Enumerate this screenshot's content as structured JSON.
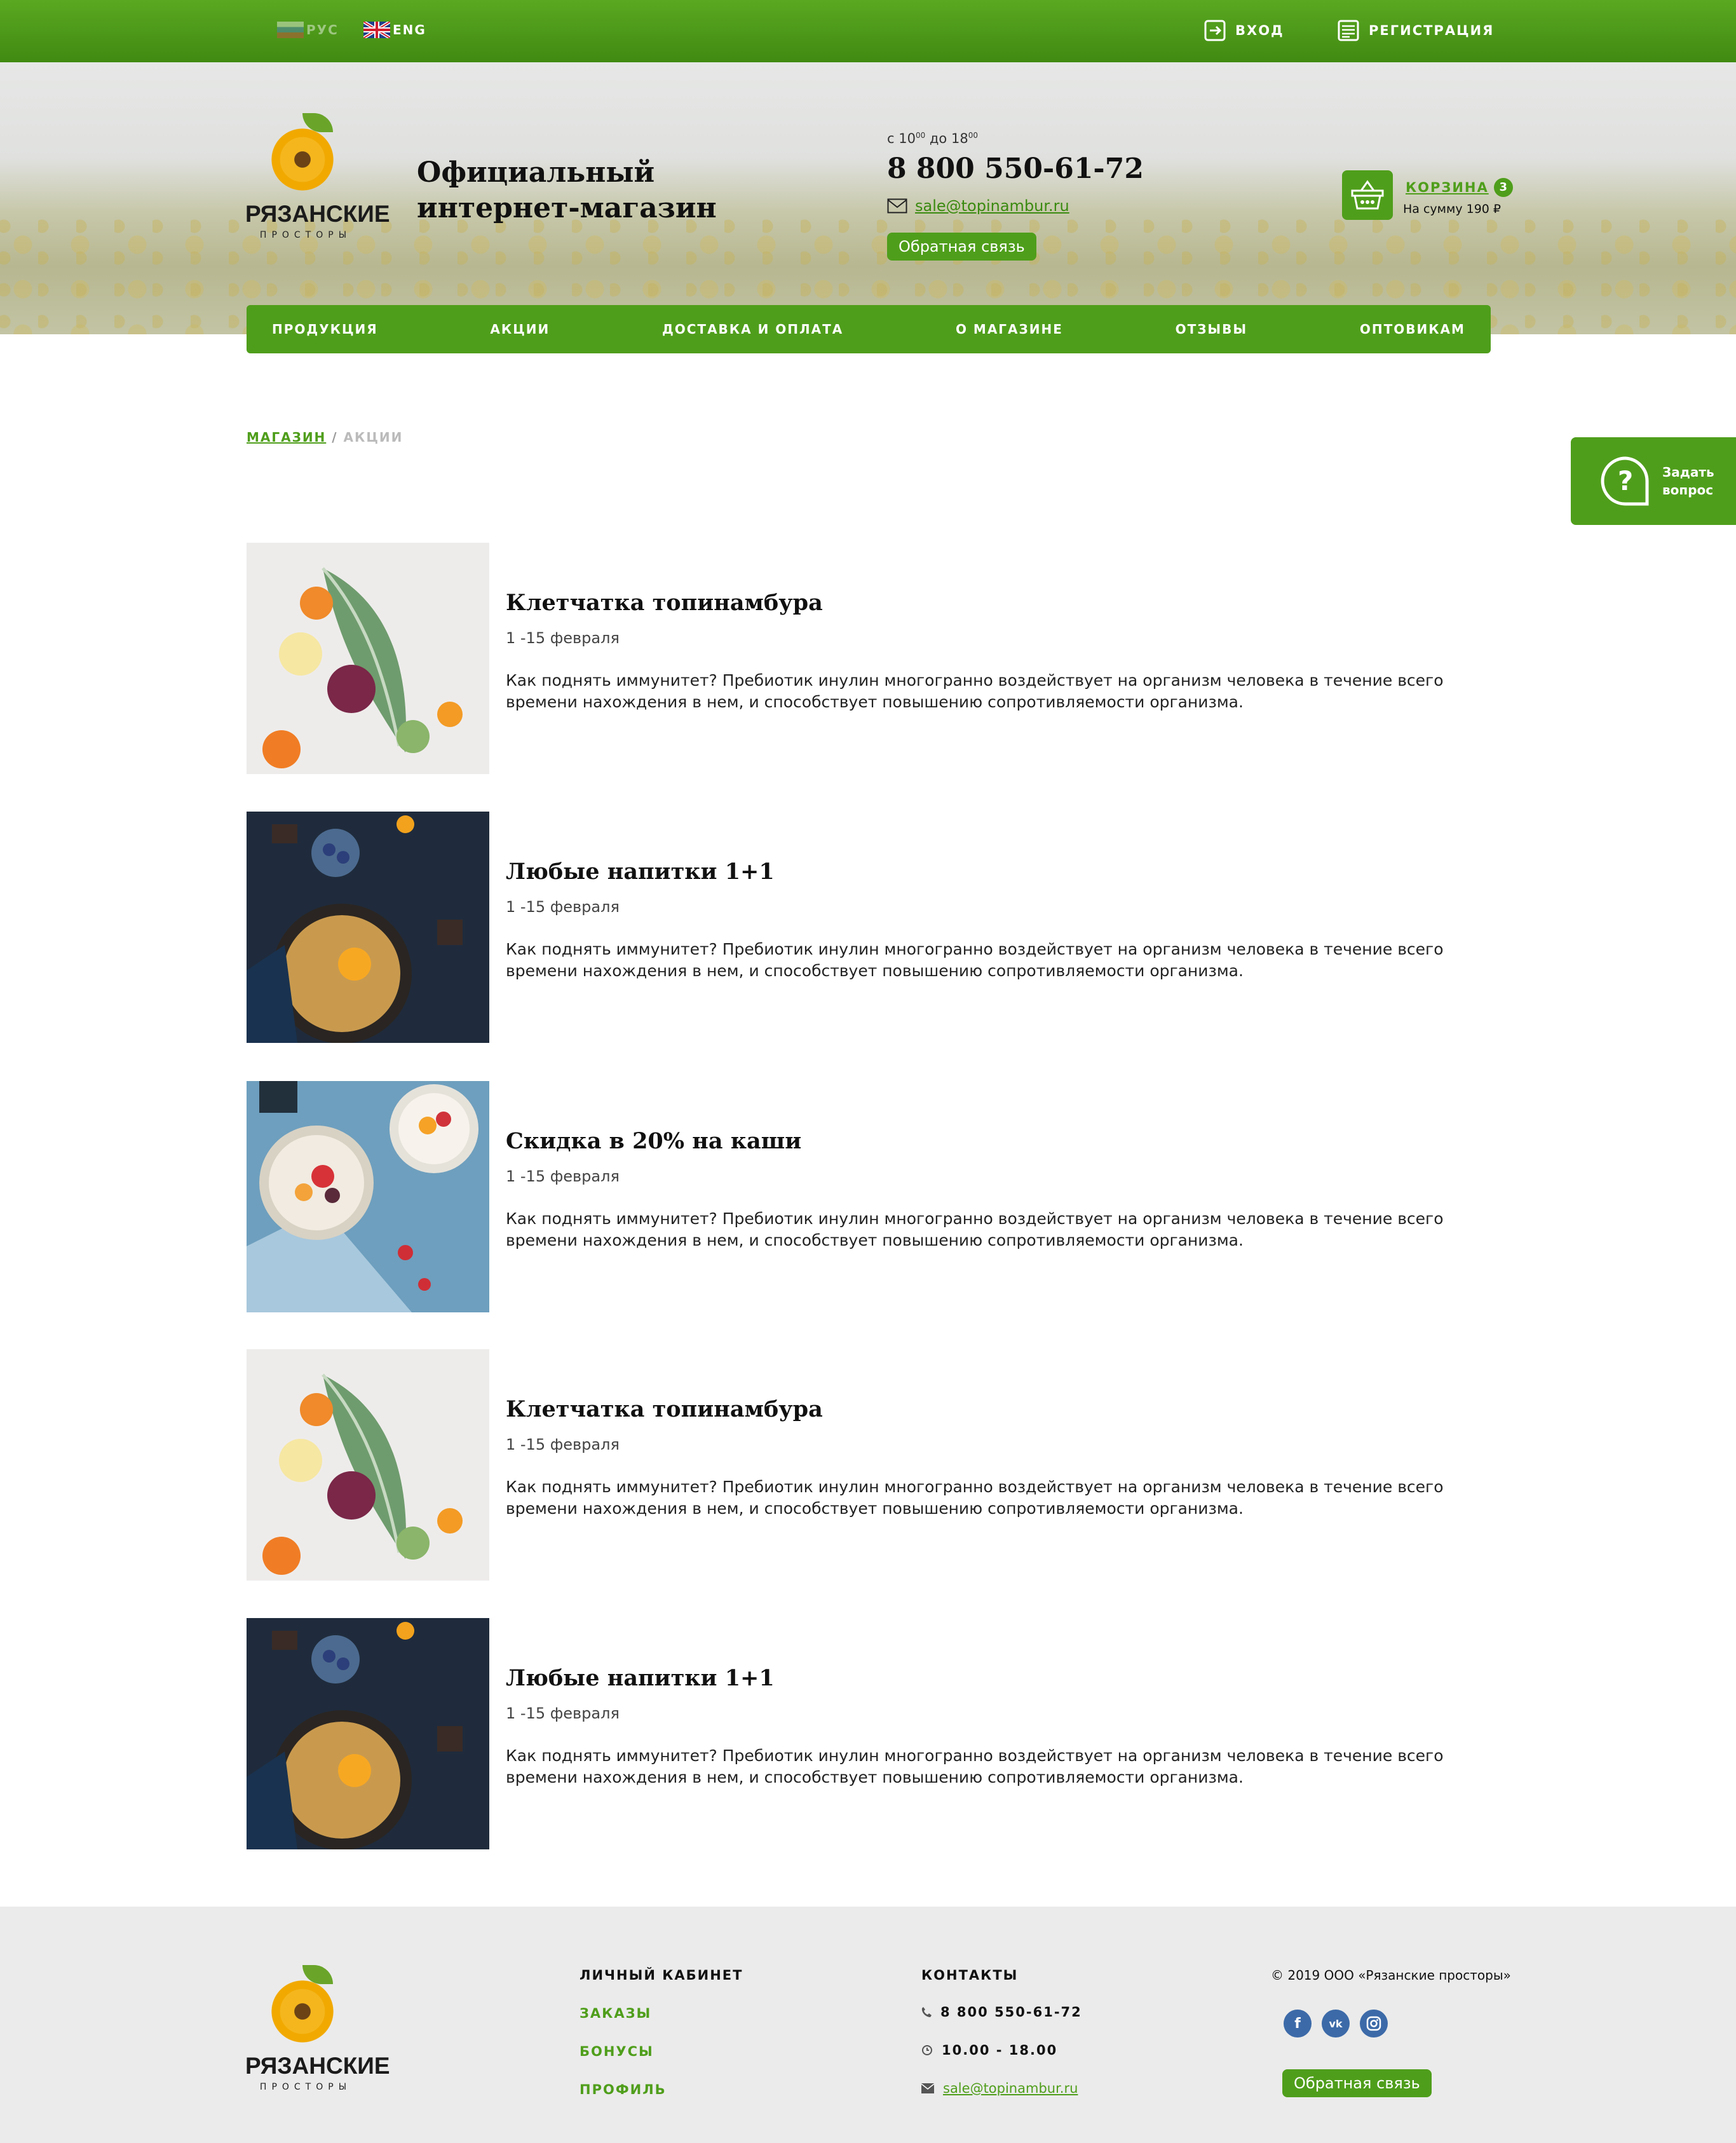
{
  "topbar": {
    "lang_ru": "РУС",
    "lang_en": "ENG",
    "login": "ВХОД",
    "register": "РЕГИСТРАЦИЯ"
  },
  "header": {
    "logo_brand": "РЯЗАНСКИЕ",
    "logo_sub": "ПРОСТОРЫ",
    "title_line1": "Официальный",
    "title_line2": "интернет-магазин",
    "hours_from": "с 10",
    "hours_from_sup": "00",
    "hours_to": " до 18",
    "hours_to_sup": "00",
    "phone": "8 800 550-61-72",
    "email": "sale@topinambur.ru",
    "feedback": "Обратная связь",
    "cart_label": "КОРЗИНА",
    "cart_count": "3",
    "cart_sum": "На сумму 190 ₽"
  },
  "nav": {
    "items": [
      "ПРОДУКЦИЯ",
      "АКЦИИ",
      "ДОСТАВКА И ОПЛАТА",
      "О МАГАЗИНЕ",
      "ОТЗЫВЫ",
      "ОПТОВИКАМ"
    ]
  },
  "breadcrumb": {
    "home": "МАГАЗИН",
    "sep": "/",
    "current": "АКЦИИ"
  },
  "ask": {
    "line1": "Задать",
    "line2": "вопрос"
  },
  "promos": [
    {
      "title": "Клетчатка топинамбура",
      "date": "1 -15 февраля",
      "text": "Как поднять иммунитет? Пребиотик инулин многогранно воздействует на организм человека в течение всего времени нахождения в нем, и способствует повышению сопротивляемости организма.",
      "image": "kale"
    },
    {
      "title": "Любые напитки 1+1",
      "date": "1 -15 февраля",
      "text": "Как поднять иммунитет? Пребиотик инулин многогранно воздействует на организм человека в течение всего времени нахождения в нем, и способствует повышению сопротивляемости организма.",
      "image": "dark"
    },
    {
      "title": "Скидка в 20% на каши",
      "date": "1 -15 февраля",
      "text": "Как поднять иммунитет? Пребиотик инулин многогранно воздействует на организм человека в течение всего времени нахождения в нем, и способствует повышению сопротивляемости организма.",
      "image": "blue"
    },
    {
      "title": "Клетчатка топинамбура",
      "date": "1 -15 февраля",
      "text": "Как поднять иммунитет? Пребиотик инулин многогранно воздействует на организм человека в течение всего времени нахождения в нем, и способствует повышению сопротивляемости организма.",
      "image": "kale"
    },
    {
      "title": "Любые напитки 1+1",
      "date": "1 -15 февраля",
      "text": "Как поднять иммунитет? Пребиотик инулин многогранно воздействует на организм человека в течение всего времени нахождения в нем, и способствует повышению сопротивляемости организма.",
      "image": "dark"
    }
  ],
  "footer": {
    "logo_brand": "РЯЗАНСКИЕ",
    "logo_sub": "ПРОСТОРЫ",
    "account_head": "ЛИЧНЫЙ КАБИНЕТ",
    "account_links": [
      "ЗАКАЗЫ",
      "БОНУСЫ",
      "ПРОФИЛЬ"
    ],
    "contacts_head": "КОНТАКТЫ",
    "phone": "8 800 550-61-72",
    "hours": "10.00 - 18.00",
    "email": "sale@topinambur.ru",
    "copyright": "© 2019 ООО «Рязанские просторы»",
    "social": [
      "facebook-icon",
      "vk-icon",
      "instagram-icon"
    ],
    "feedback": "Обратная связь"
  },
  "colors": {
    "accent": "#4f9e1b",
    "topbar": "#4a9817",
    "footer_bg": "#ebebeb"
  }
}
